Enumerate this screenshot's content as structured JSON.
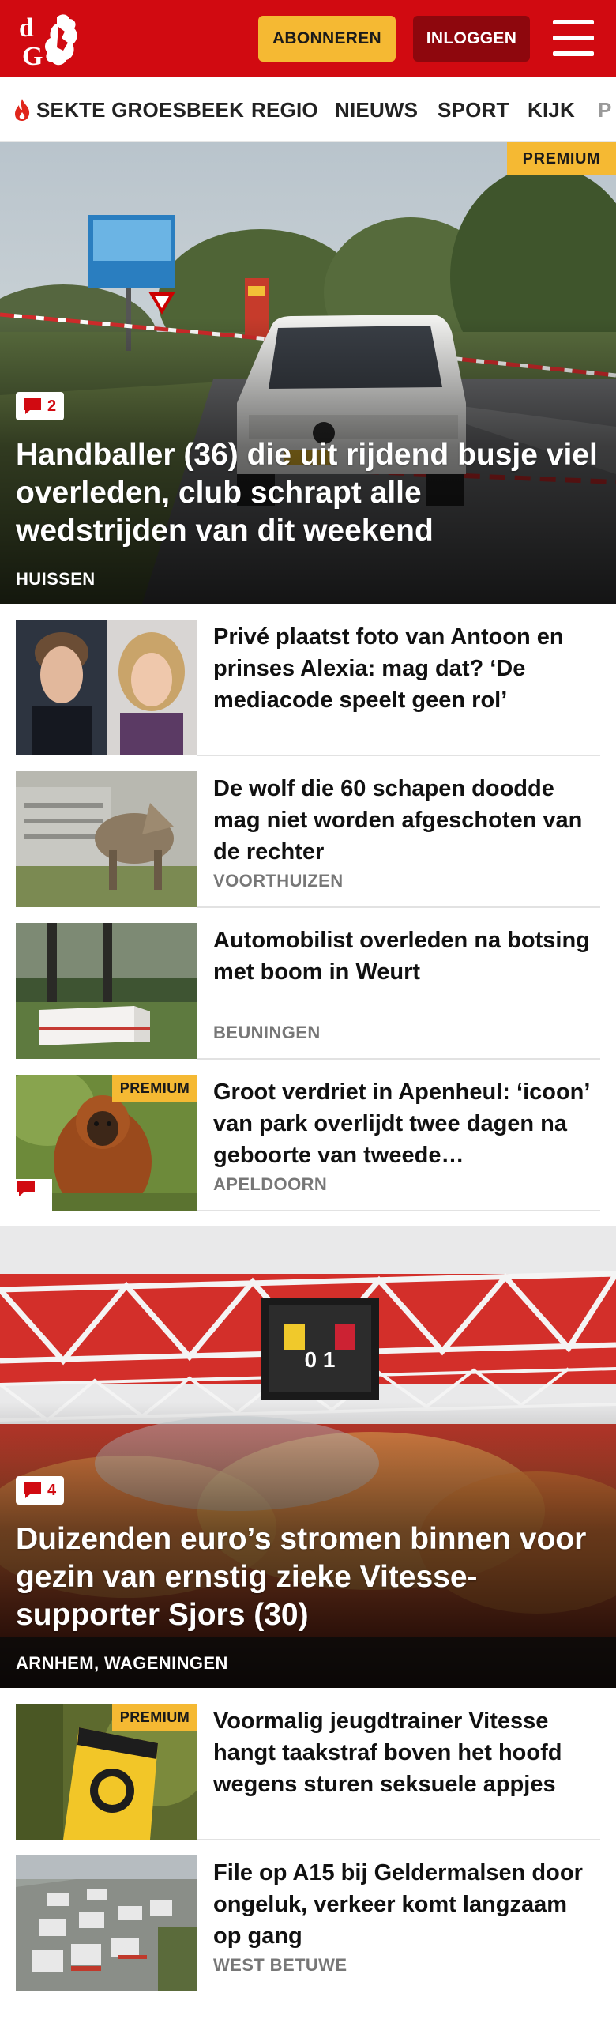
{
  "header": {
    "logo_text": "dG",
    "subscribe_label": "ABONNEREN",
    "login_label": "INLOGGEN",
    "brand_color": "#d10a11",
    "accent_color": "#f5b933"
  },
  "nav": {
    "items": [
      {
        "label": "SEKTE GROESBEEK",
        "icon": "flame-icon"
      },
      {
        "label": "REGIO"
      },
      {
        "label": "NIEUWS"
      },
      {
        "label": "SPORT"
      },
      {
        "label": "KIJK"
      },
      {
        "label": "P"
      }
    ]
  },
  "hero1": {
    "premium": "PREMIUM",
    "comments": "2",
    "title": "Handballer (36) die uit rijdend busje viel overleden, club schrapt alle wedstrijden van dit weekend",
    "location": "HUISSEN"
  },
  "articles_a": [
    {
      "title": "Privé plaatst foto van Antoon en prinses Alexia: mag dat? ‘De mediacode speelt geen rol’",
      "location": ""
    },
    {
      "title": "De wolf die 60 schapen doodde mag niet worden afgeschoten van de rechter",
      "location": "VOORTHUIZEN"
    },
    {
      "title": "Automobilist overleden na botsing met boom in Weurt",
      "location": "BEUNINGEN"
    },
    {
      "title": "Groot verdriet in Apenheul: ‘icoon’ van park overlijdt twee dagen na geboorte van tweede…",
      "location": "APELDOORN",
      "premium": "PREMIUM"
    }
  ],
  "hero2": {
    "comments": "4",
    "title": "Duizenden euro’s stromen binnen voor gezin van ernstig zieke Vitesse-supporter Sjors (30)",
    "location": "ARNHEM, WAGENINGEN",
    "scoreboard": "0 1"
  },
  "articles_b": [
    {
      "title": "Voormalig jeugdtrainer Vitesse hangt taakstraf boven het hoofd wegens sturen seksuele appjes",
      "location": "",
      "premium": "PREMIUM"
    },
    {
      "title": "File op A15 bij Geldermalsen door ongeluk, verkeer komt langzaam op gang",
      "location": "WEST BETUWE"
    }
  ]
}
